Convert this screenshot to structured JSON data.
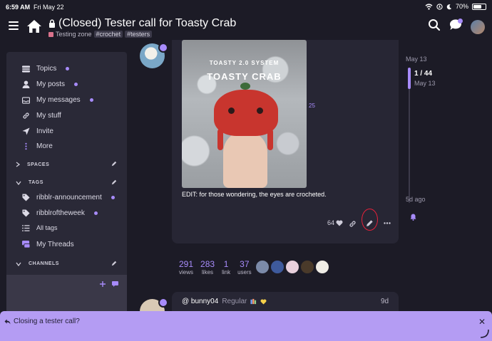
{
  "status_bar": {
    "time": "6:59 AM",
    "date": "Fri May 22",
    "battery": "70%",
    "battery_level": 0.7
  },
  "header": {
    "title": "(Closed) Tester call for Toasty Crab",
    "category": "Testing zone",
    "tags": [
      "#crochet",
      "#testers"
    ]
  },
  "sidebar": {
    "items": [
      {
        "label": "Topics",
        "icon": "topics-icon",
        "dot": true
      },
      {
        "label": "My posts",
        "icon": "user-icon",
        "dot": true
      },
      {
        "label": "My messages",
        "icon": "inbox-icon",
        "dot": true
      },
      {
        "label": "My stuff",
        "icon": "link-icon",
        "dot": false
      },
      {
        "label": "Invite",
        "icon": "send-icon",
        "dot": false
      },
      {
        "label": "More",
        "icon": "more-vertical-icon",
        "dot": false
      }
    ],
    "sections": {
      "spaces": "SPACES",
      "tags": "TAGS",
      "channels": "CHANNELS"
    },
    "tags": [
      {
        "label": "ribblr-announcement",
        "dot": true
      },
      {
        "label": "ribblroftheweek",
        "dot": true
      },
      {
        "label": "All tags",
        "dot": false
      }
    ],
    "my_threads": "My Threads"
  },
  "post": {
    "image_title_small": "TOASTY 2.0 SYSTEM",
    "image_title_big": "TOASTY CRAB",
    "image_count": "25",
    "text": "EDIT: for those wondering, the eyes are crocheted.",
    "likes": "64",
    "accent": "#a78bfa",
    "highlight_color": "#e5213a"
  },
  "timeline": {
    "top_date": "May 13",
    "count": "1 / 44",
    "current_date": "May 13",
    "bottom": "5d ago"
  },
  "stats": [
    {
      "num": "291",
      "label": "views"
    },
    {
      "num": "283",
      "label": "likes"
    },
    {
      "num": "1",
      "label": "link"
    },
    {
      "num": "37",
      "label": "users"
    }
  ],
  "reply": {
    "user": "@ bunny04",
    "rank": "Regular",
    "time": "9d"
  },
  "composer": {
    "text": "Closing a tester call?"
  }
}
